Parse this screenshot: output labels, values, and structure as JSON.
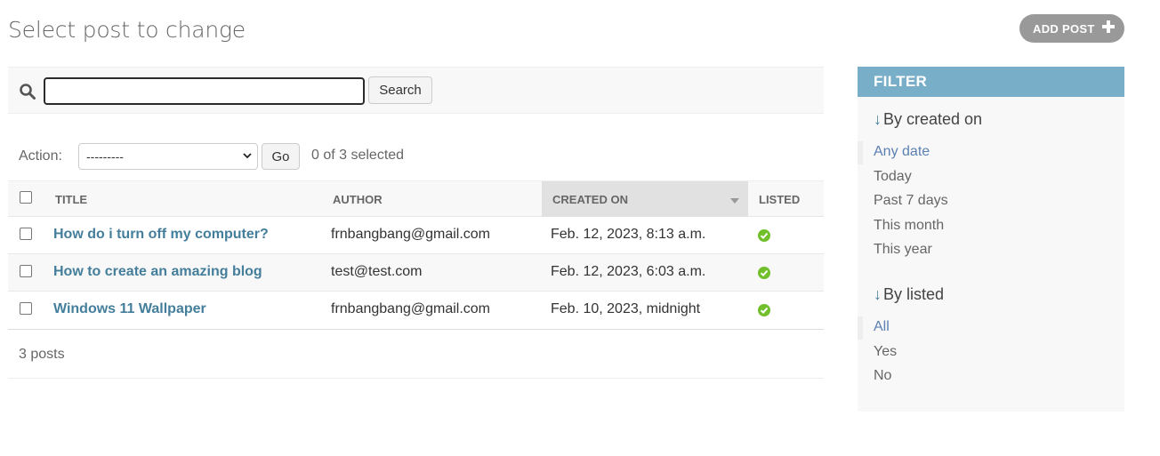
{
  "header": {
    "title": "Select post to change",
    "add_button": "ADD POST"
  },
  "search": {
    "value": "",
    "button": "Search"
  },
  "actions": {
    "label": "Action:",
    "selected_option": "---------",
    "go": "Go",
    "selected_count": "0 of 3 selected"
  },
  "table": {
    "headers": [
      "TITLE",
      "AUTHOR",
      "CREATED ON",
      "LISTED"
    ],
    "rows": [
      {
        "title": "How do i turn off my computer?",
        "author": "frnbangbang@gmail.com",
        "created_on": "Feb. 12, 2023, 8:13 a.m.",
        "listed": true
      },
      {
        "title": "How to create an amazing blog",
        "author": "test@test.com",
        "created_on": "Feb. 12, 2023, 6:03 a.m.",
        "listed": true
      },
      {
        "title": "Windows 11 Wallpaper",
        "author": "frnbangbang@gmail.com",
        "created_on": "Feb. 10, 2023, midnight",
        "listed": true
      }
    ]
  },
  "paginator": "3 posts",
  "filter": {
    "heading": "FILTER",
    "arrow": "↓",
    "groups": [
      {
        "title": "By created on",
        "items": [
          "Any date",
          "Today",
          "Past 7 days",
          "This month",
          "This year"
        ],
        "selected": "Any date"
      },
      {
        "title": "By listed",
        "items": [
          "All",
          "Yes",
          "No"
        ],
        "selected": "All"
      }
    ]
  },
  "colors": {
    "link": "#447e9b",
    "filter_header": "#79aec8",
    "listed_icon": "#70bf2b",
    "add_button": "#999999"
  }
}
